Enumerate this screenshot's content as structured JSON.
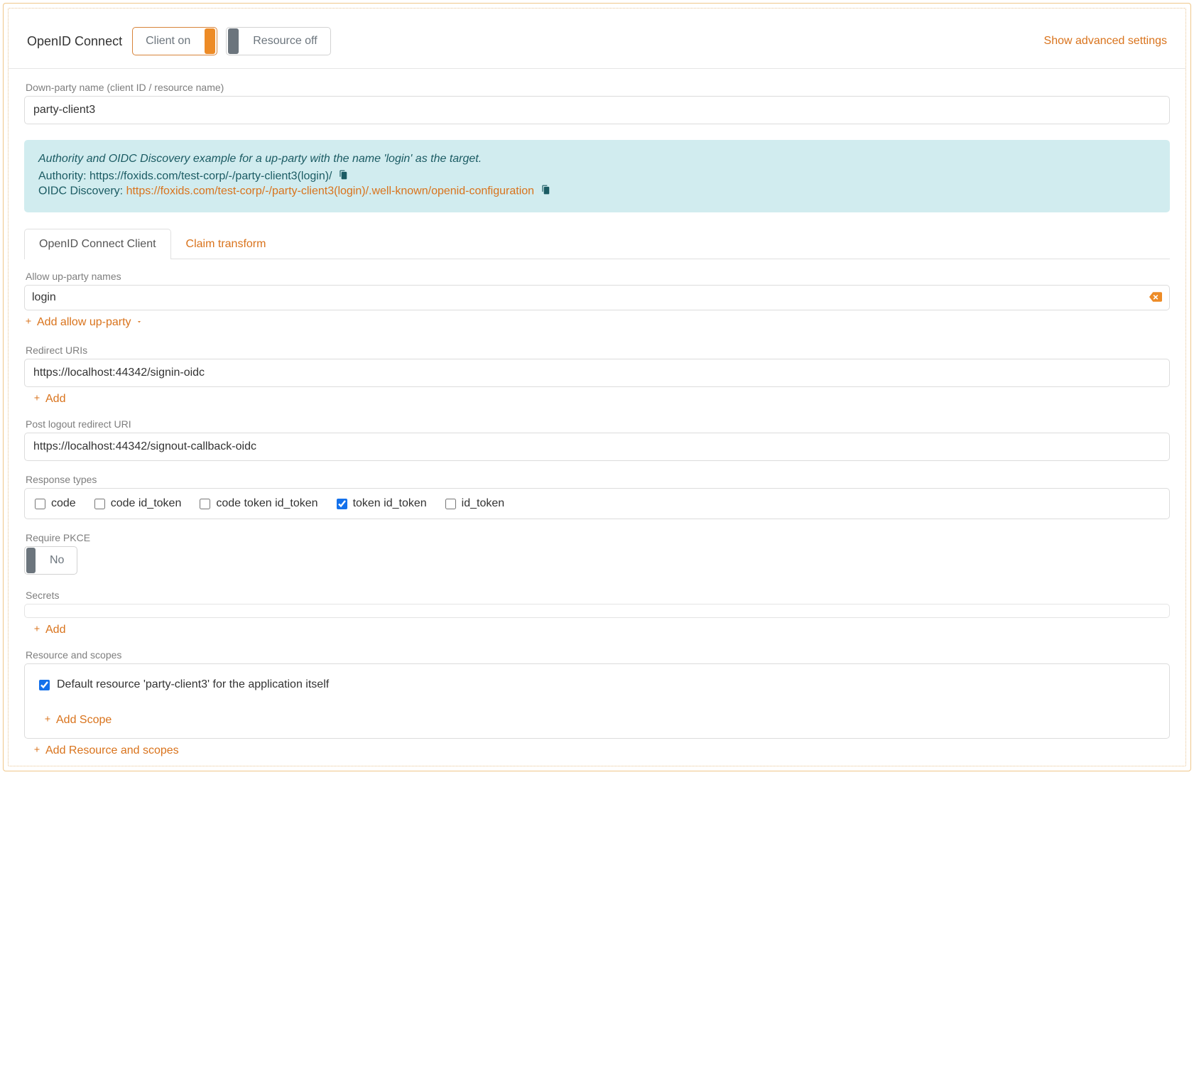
{
  "header": {
    "title": "OpenID Connect",
    "client_toggle": "Client on",
    "resource_toggle": "Resource off",
    "advanced_link": "Show advanced settings"
  },
  "party_name": {
    "label": "Down-party name (client ID / resource name)",
    "value": "party-client3"
  },
  "info": {
    "intro": "Authority and OIDC Discovery example for a up-party with the name 'login' as the target.",
    "authority_label": "Authority: ",
    "authority_value": "https://foxids.com/test-corp/-/party-client3(login)/",
    "discovery_label": "OIDC Discovery: ",
    "discovery_value": "https://foxids.com/test-corp/-/party-client3(login)/.well-known/openid-configuration"
  },
  "tabs": {
    "client": "OpenID Connect Client",
    "claim": "Claim transform"
  },
  "allow_up": {
    "label": "Allow up-party names",
    "value": "login",
    "add": "Add allow up-party"
  },
  "redirect": {
    "label": "Redirect URIs",
    "value": "https://localhost:44342/signin-oidc",
    "add": "Add"
  },
  "post_logout": {
    "label": "Post logout redirect URI",
    "value": "https://localhost:44342/signout-callback-oidc"
  },
  "response_types": {
    "label": "Response types",
    "options": [
      {
        "label": "code",
        "checked": false
      },
      {
        "label": "code id_token",
        "checked": false
      },
      {
        "label": "code token id_token",
        "checked": false
      },
      {
        "label": "token id_token",
        "checked": true
      },
      {
        "label": "id_token",
        "checked": false
      }
    ]
  },
  "pkce": {
    "label": "Require PKCE",
    "value": "No"
  },
  "secrets": {
    "label": "Secrets",
    "add": "Add"
  },
  "res_scopes": {
    "label": "Resource and scopes",
    "default_text": "Default resource 'party-client3' for the application itself",
    "add_scope": "Add Scope",
    "add_res": "Add Resource and scopes"
  }
}
